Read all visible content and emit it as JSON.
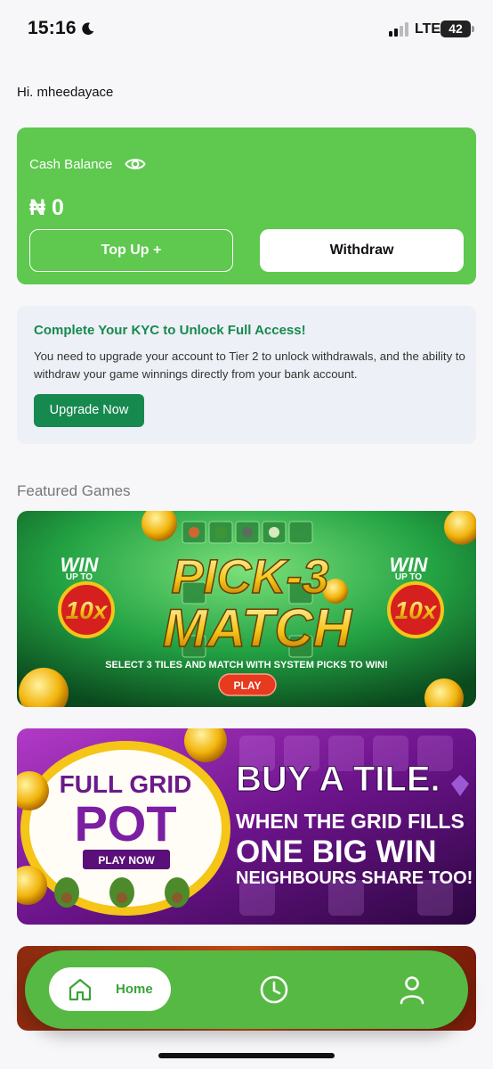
{
  "status_bar": {
    "time": "15:16",
    "network": "LTE",
    "battery": "42"
  },
  "greeting": "Hi. mheedayace",
  "balance": {
    "label": "Cash Balance",
    "amount": "₦ 0",
    "topup_label": "Top Up +",
    "withdraw_label": "Withdraw"
  },
  "kyc": {
    "title": "Complete Your KYC to Unlock Full Access!",
    "body": "You need to upgrade your account to Tier 2 to unlock withdrawals, and the ability to withdraw your game winnings directly from your bank account.",
    "button_label": "Upgrade Now"
  },
  "featured": {
    "title": "Featured Games",
    "games": [
      {
        "win_line1": "WIN",
        "win_line2": "UP TO",
        "multiplier": "10x",
        "title_line1": "PICK-3",
        "title_line2": "MATCH",
        "tagline": "SELECT 3 TILES AND MATCH WITH SYSTEM PICKS TO WIN!",
        "play_label": "PLAY"
      },
      {
        "badge_line1": "FULL GRID",
        "badge_line2": "POT",
        "play_label": "PLAY NOW",
        "line1": "BUY A TILE.",
        "line2": "WHEN THE GRID FILLS",
        "line3": "ONE BIG WIN",
        "line4": "NEIGHBOURS SHARE TOO!"
      }
    ]
  },
  "bottom_nav": {
    "home_label": "Home"
  },
  "colors": {
    "primary_green": "#5ec84f",
    "dark_green": "#16894f",
    "nav_green": "#56b943",
    "kyc_bg": "#edf0f6"
  },
  "icons": [
    "moon-icon",
    "signal-icon",
    "eye-icon",
    "home-icon",
    "clock-icon",
    "user-icon"
  ]
}
